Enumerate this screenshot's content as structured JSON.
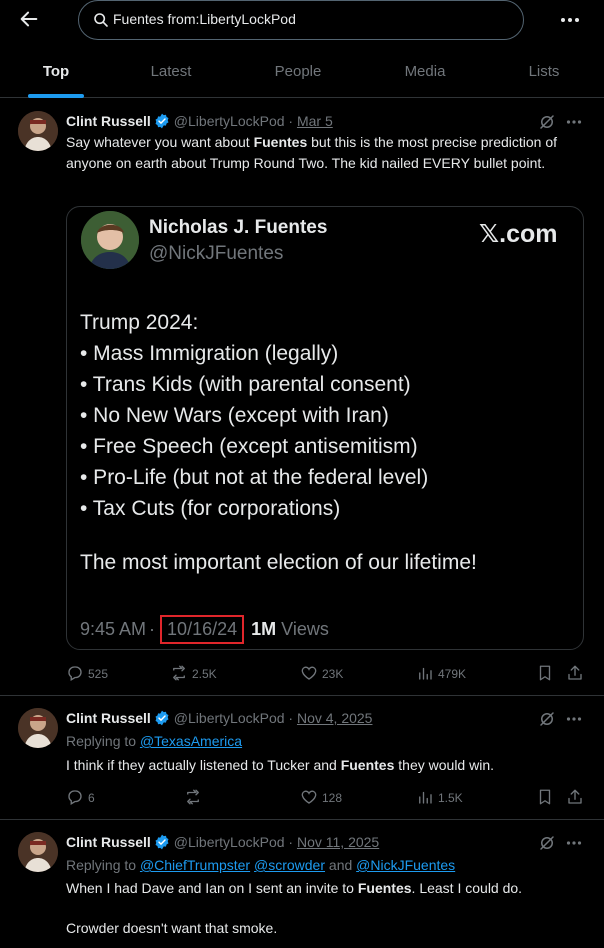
{
  "header": {
    "search_query": "Fuentes from:LibertyLockPod"
  },
  "tabs": [
    {
      "label": "Top",
      "active": true
    },
    {
      "label": "Latest",
      "active": false
    },
    {
      "label": "People",
      "active": false
    },
    {
      "label": "Media",
      "active": false
    },
    {
      "label": "Lists",
      "active": false
    }
  ],
  "colors": {
    "accent": "#1d9bf0",
    "verified": "#1d9bf0",
    "highlight_box": "#e0262b",
    "muted": "#71767b"
  },
  "tweets": [
    {
      "author": "Clint Russell",
      "handle": "@LibertyLockPod",
      "separator": "·",
      "date": "Mar 5",
      "text": {
        "p1": "Say whatever you want about ",
        "bold": "Fuentes",
        "p2": " but this is the most precise prediction of anyone on earth about Trump Round Two. The kid nailed EVERY bullet point."
      },
      "card": {
        "name": "Nicholas J. Fuentes",
        "handle": "@NickJFuentes",
        "brand": "𝕏.com",
        "lines": [
          "Trump 2024:",
          "• Mass Immigration (legally)",
          "• Trans Kids (with parental consent)",
          "• No New Wars (except with Iran)",
          "• Free Speech (except antisemitism)",
          "• Pro-Life (but not at the federal level)",
          "• Tax Cuts (for corporations)"
        ],
        "closing": "The most important election of our lifetime!",
        "time": "9:45 AM",
        "sep": "·",
        "date": "10/16/24",
        "views_num": "1M",
        "views_label": "Views"
      },
      "stats": {
        "replies": "525",
        "reposts": "2.5K",
        "likes": "23K",
        "views": "479K"
      }
    },
    {
      "author": "Clint Russell",
      "handle": "@LibertyLockPod",
      "separator": "·",
      "date": "Nov 4, 2025",
      "reply_prefix": "Replying to ",
      "reply_to": "@TexasAmerica",
      "text": {
        "p1": "I think if they actually listened to Tucker and ",
        "bold": "Fuentes",
        "p2": " they would win."
      },
      "stats": {
        "replies": "6",
        "reposts": "",
        "likes": "128",
        "views": "1.5K"
      }
    },
    {
      "author": "Clint Russell",
      "handle": "@LibertyLockPod",
      "separator": "·",
      "date": "Nov 11, 2025",
      "reply_prefix": "Replying to ",
      "reply_to_1": "@ChiefTrumpster",
      "reply_to_2": "@scrowder",
      "reply_and": " and ",
      "reply_to_3": "@NickJFuentes",
      "text": {
        "p1": "When I had Dave and Ian on I sent an invite to ",
        "bold": "Fuentes",
        "p2": ". Least I could do.",
        "p3": "Crowder doesn't want that smoke."
      }
    }
  ]
}
